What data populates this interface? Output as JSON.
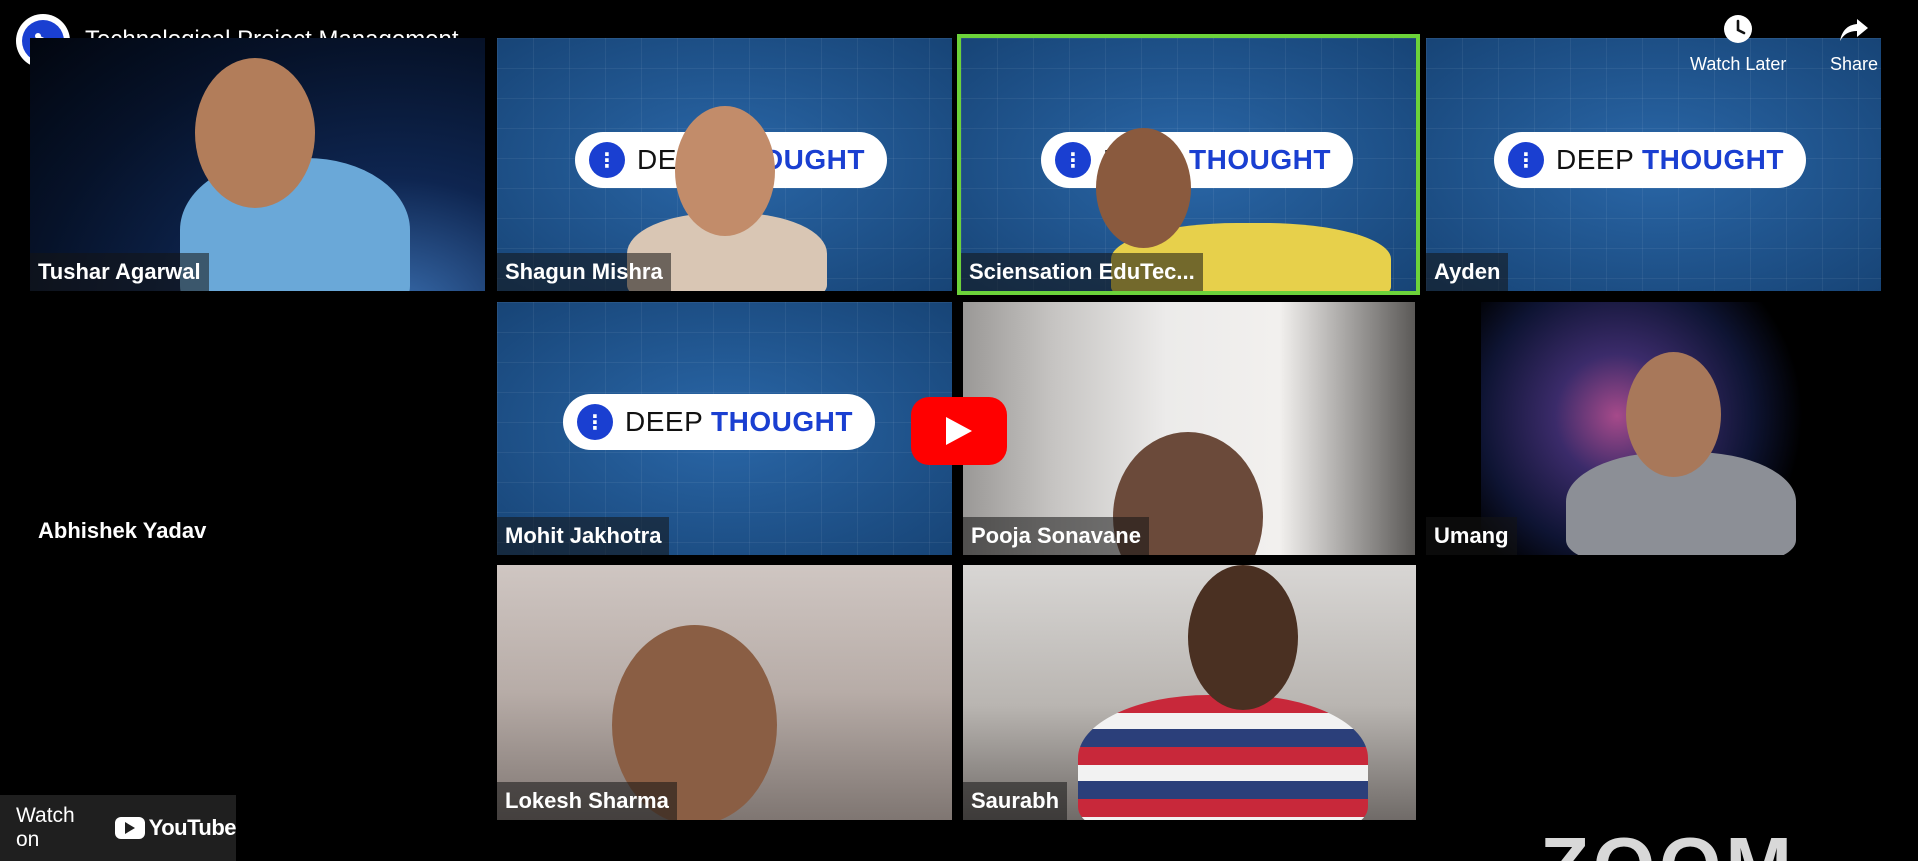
{
  "video": {
    "title": "Technological Project Management",
    "channel_avatar_glyph": "⋮"
  },
  "actions": {
    "watch_later": "Watch Later",
    "share": "Share"
  },
  "logo_text": {
    "deep": "DEEP",
    "thought": "THOUGHT"
  },
  "participants": [
    {
      "name": "Tushar Agarwal"
    },
    {
      "name": "Shagun Mishra"
    },
    {
      "name": "Sciensation EduTec..."
    },
    {
      "name": "Ayden"
    },
    {
      "name": "Abhishek Yadav"
    },
    {
      "name": "Mohit Jakhotra"
    },
    {
      "name": "Pooja Sonavane"
    },
    {
      "name": "Umang"
    },
    {
      "name": "Lokesh Sharma"
    },
    {
      "name": "Saurabh"
    }
  ],
  "footer": {
    "watch_on": "Watch on",
    "youtube": "YouTube",
    "zoom_watermark": "ZOOM"
  },
  "colors": {
    "active_speaker": "#6cd23a",
    "play_button": "#ff0000",
    "brand_blue": "#1a3fd1"
  },
  "icons": {
    "watch_later": "clock-icon",
    "share": "share-arrow-icon",
    "play": "play-icon"
  }
}
